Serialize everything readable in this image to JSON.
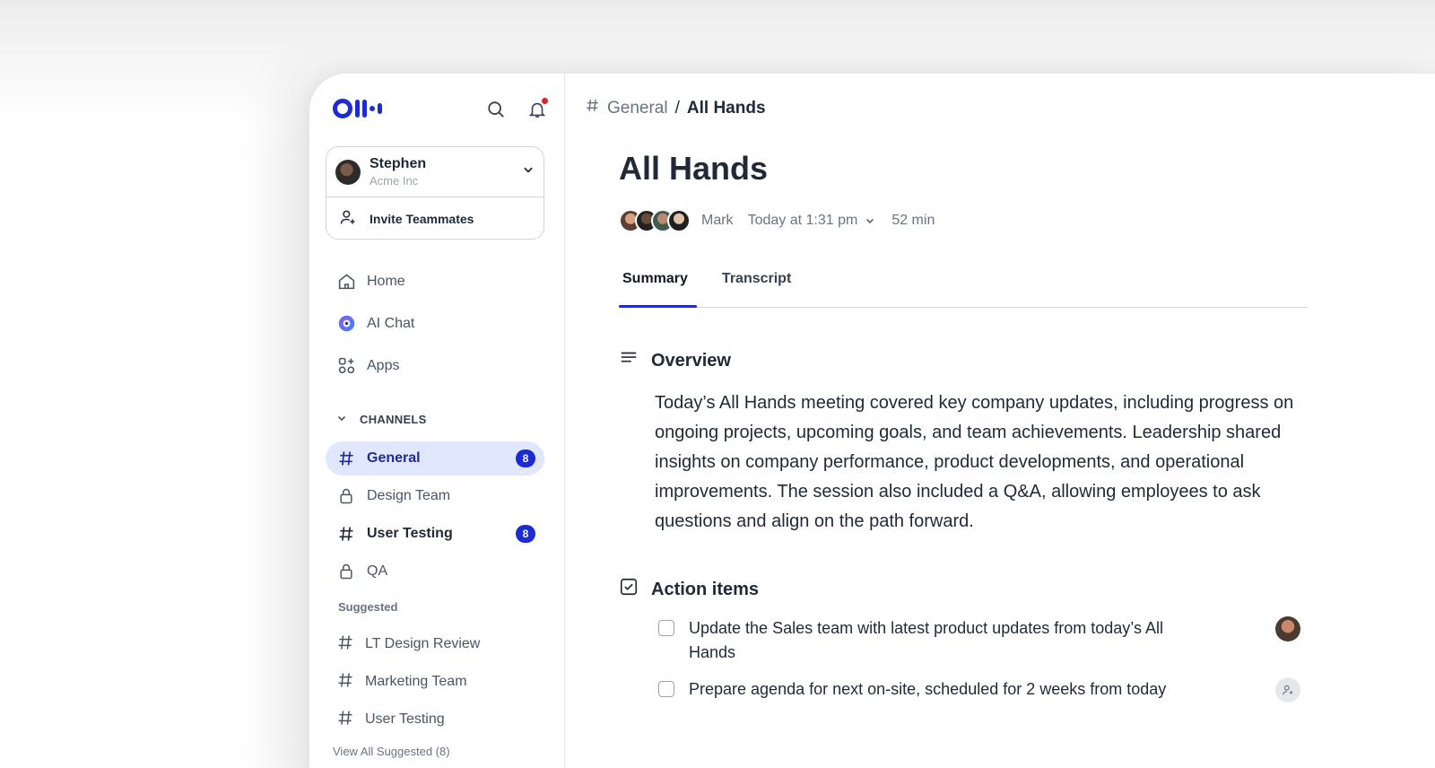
{
  "sidebar": {
    "account": {
      "name": "Stephen",
      "org": "Acme Inc"
    },
    "invite_label": "Invite Teammates",
    "nav": [
      {
        "label": "Home",
        "icon": "home-icon"
      },
      {
        "label": "AI Chat",
        "icon": "ai-chat-icon"
      },
      {
        "label": "Apps",
        "icon": "apps-icon"
      }
    ],
    "channels_header": "CHANNELS",
    "channels": [
      {
        "label": "General",
        "icon": "hash-icon",
        "badge": "8",
        "active": true
      },
      {
        "label": "Design Team",
        "icon": "lock-icon"
      },
      {
        "label": "User Testing",
        "icon": "hash-icon",
        "badge": "8"
      },
      {
        "label": "QA",
        "icon": "lock-icon"
      }
    ],
    "suggested_header": "Suggested",
    "suggested": [
      {
        "label": "LT Design Review"
      },
      {
        "label": "Marketing Team"
      },
      {
        "label": "User Testing"
      }
    ],
    "view_all": "View All Suggested (8)"
  },
  "main": {
    "breadcrumb": {
      "channel": "General",
      "separator": "/",
      "current": "All Hands"
    },
    "title": "All Hands",
    "meta": {
      "owner": "Mark",
      "date": "Today at 1:31 pm",
      "duration": "52 min"
    },
    "tabs": [
      "Summary",
      "Transcript"
    ],
    "overview": {
      "title": "Overview",
      "text": "Today’s All Hands meeting covered key company updates, including progress on ongoing projects, upcoming goals, and team achievements. Leadership shared insights on company performance, product developments, and operational improvements. The session also included a Q&A, allowing employees to ask questions and align on the path forward."
    },
    "action_items": {
      "title": "Action items",
      "items": [
        {
          "text": "Update the Sales team with latest product updates from today’s All Hands",
          "assignee": "avatar"
        },
        {
          "text": "Prepare agenda for next on-site, scheduled for 2 weeks from today",
          "assignee": "add-assignee-icon"
        }
      ]
    }
  },
  "colors": {
    "accent": "#1d2bd6",
    "active_bg": "#e0e7ff",
    "notification": "#dc2626"
  }
}
